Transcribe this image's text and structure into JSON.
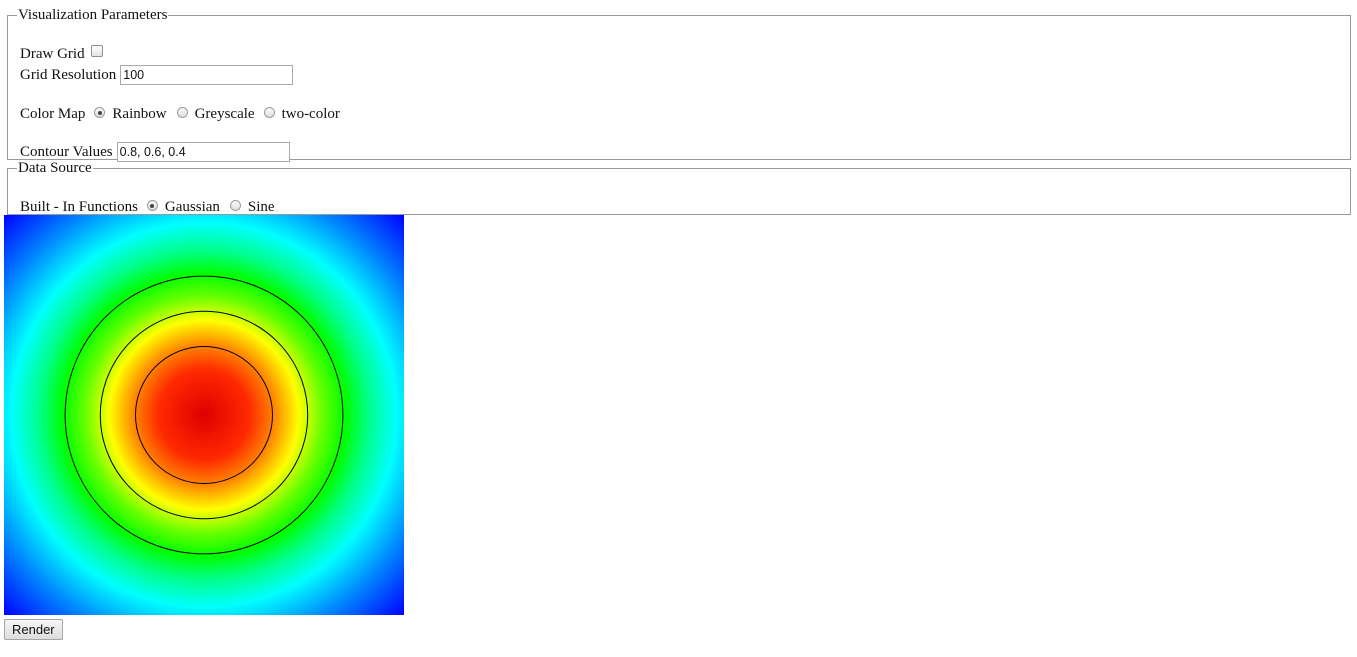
{
  "visualization": {
    "legend": "Visualization Parameters",
    "draw_grid": {
      "label": "Draw Grid",
      "checked": false
    },
    "grid_resolution": {
      "label": "Grid Resolution",
      "value": "100"
    },
    "color_map": {
      "label": "Color Map",
      "options": [
        {
          "label": "Rainbow",
          "checked": true
        },
        {
          "label": "Greyscale",
          "checked": false
        },
        {
          "label": "two-color",
          "checked": false
        }
      ]
    },
    "contour_values": {
      "label": "Contour Values",
      "value": "0.8, 0.6, 0.4"
    }
  },
  "data_source": {
    "legend": "Data Source",
    "label": "Built - In Functions",
    "options": [
      {
        "label": "Gaussian",
        "checked": true
      },
      {
        "label": "Sine",
        "checked": false
      }
    ]
  },
  "render": {
    "label": "Render"
  },
  "plot": {
    "function": "Gaussian",
    "color_map": "Rainbow",
    "contours": [
      0.8,
      0.6,
      0.4
    ],
    "contour_color": "#000000",
    "colors": {
      "low": "#0000ff",
      "mid_low": "#00ffff",
      "mid": "#00ff00",
      "mid_high": "#ffff00",
      "high": "#ff0000"
    }
  }
}
